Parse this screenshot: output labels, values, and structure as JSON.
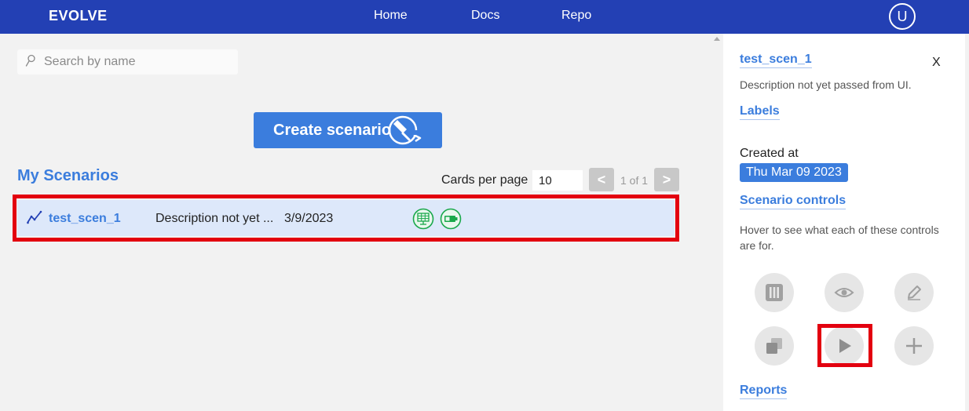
{
  "header": {
    "brand": "EVOLVE",
    "nav": {
      "home": "Home",
      "docs": "Docs",
      "repo": "Repo"
    },
    "avatar_letter": "U"
  },
  "search": {
    "placeholder": "Search by name",
    "value": ""
  },
  "create_button": {
    "label": "Create scenario"
  },
  "scenarios": {
    "title": "My Scenarios",
    "cards_per_page_label": "Cards per page",
    "cards_per_page_value": "10",
    "prev_label": "<",
    "next_label": ">",
    "page_info": "1 of 1",
    "items": [
      {
        "name": "test_scen_1",
        "description": "Description not yet ...",
        "date": "3/9/2023",
        "badges": [
          "solar-panel-icon",
          "battery-icon"
        ]
      }
    ]
  },
  "detail_panel": {
    "title": "test_scen_1",
    "close_label": "X",
    "description": "Description not yet passed from UI.",
    "labels_heading": "Labels",
    "created_label": "Created at",
    "created_value": "Thu Mar 09 2023",
    "controls_heading": "Scenario controls",
    "controls_hint": "Hover to see what each of these controls are for.",
    "controls": [
      "columns-icon",
      "eye-icon",
      "pencil-icon",
      "copy-icon",
      "play-icon",
      "plus-icon"
    ],
    "reports_heading": "Reports"
  },
  "colors": {
    "header_bg": "#2340b4",
    "accent": "#3b7ddd",
    "card_bg": "#dde8fa",
    "badge_green": "#1aa84b",
    "highlight_red": "#e3000f"
  }
}
